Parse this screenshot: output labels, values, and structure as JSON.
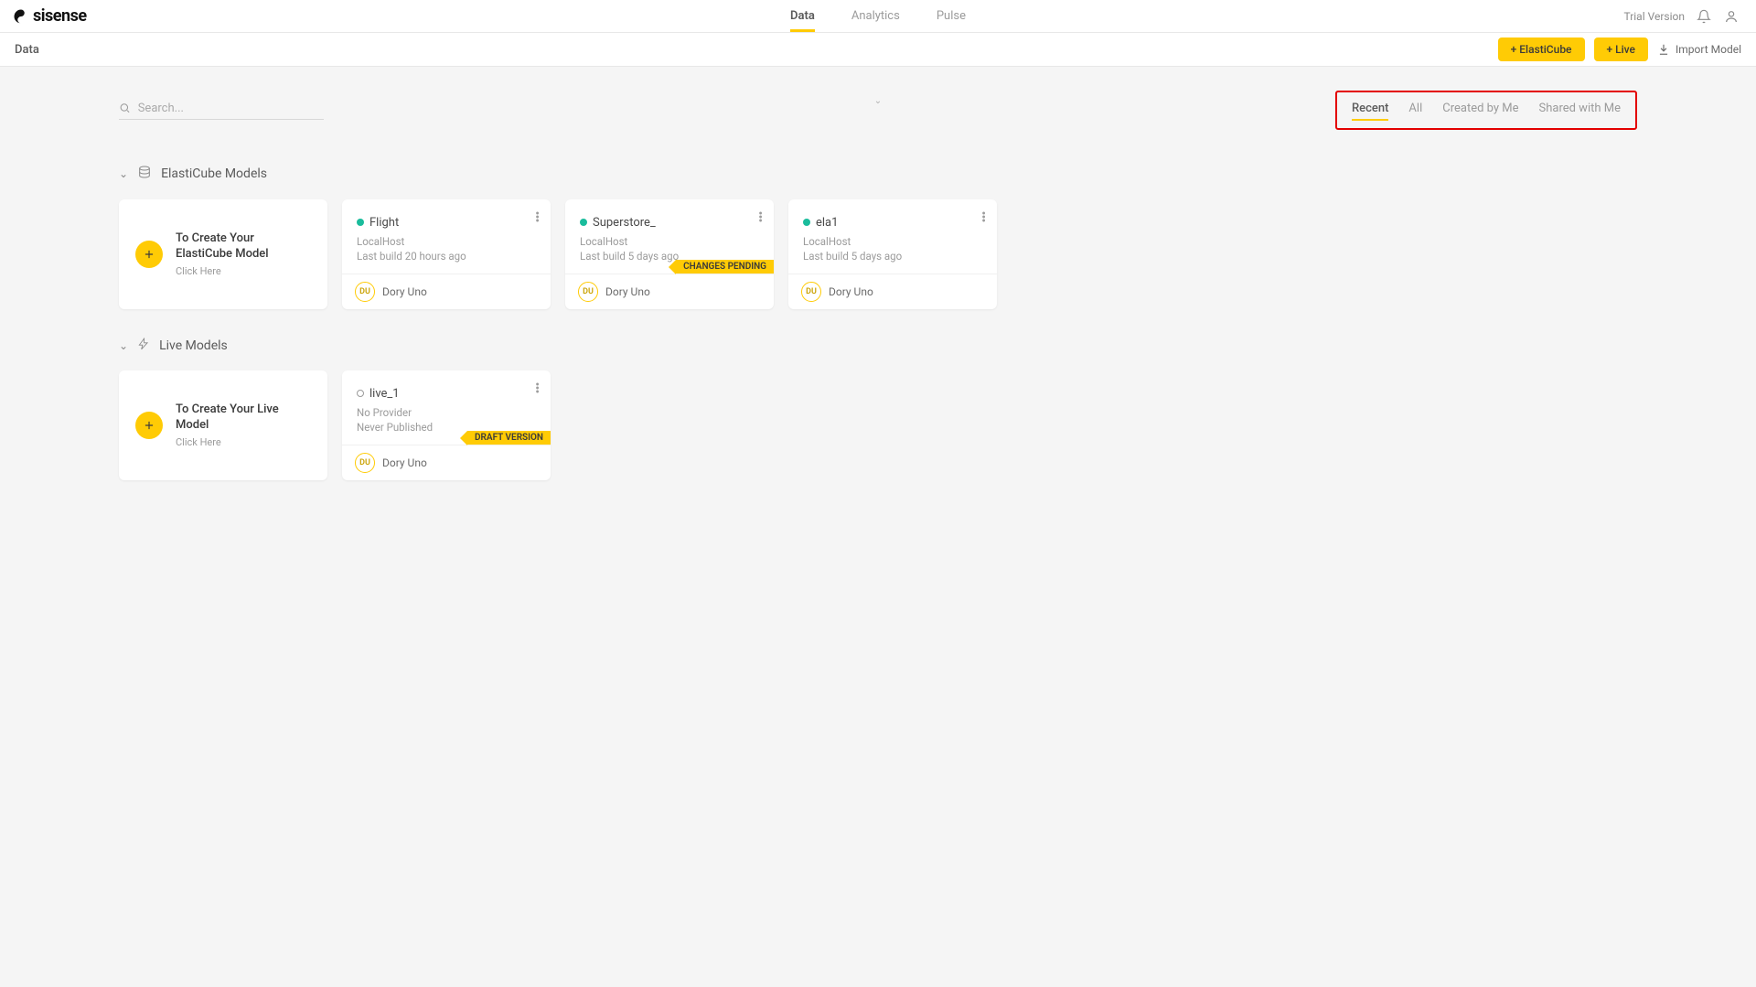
{
  "brand": "sisense",
  "topnav": {
    "tabs": [
      "Data",
      "Analytics",
      "Pulse"
    ],
    "active": 0,
    "trial": "Trial Version"
  },
  "subbar": {
    "title": "Data",
    "btn_elasticube": "+ ElastiCube",
    "btn_live": "+ Live",
    "btn_import": "Import Model"
  },
  "search": {
    "placeholder": "Search..."
  },
  "filters": {
    "tabs": [
      "Recent",
      "All",
      "Created by Me",
      "Shared with Me"
    ],
    "active": 0
  },
  "sections": {
    "elasticube": {
      "title": "ElastiCube Models",
      "create": {
        "line1": "To Create Your ElastiCube Model",
        "line2": "Click Here"
      },
      "cards": [
        {
          "name": "Flight",
          "host": "LocalHost",
          "build": "Last build 20 hours ago",
          "status": "green",
          "flag": "",
          "owner_initials": "DU",
          "owner_name": "Dory Uno"
        },
        {
          "name": "Superstore_",
          "host": "LocalHost",
          "build": "Last build 5 days ago",
          "status": "green",
          "flag": "CHANGES PENDING",
          "owner_initials": "DU",
          "owner_name": "Dory Uno"
        },
        {
          "name": "ela1",
          "host": "LocalHost",
          "build": "Last build 5 days ago",
          "status": "green",
          "flag": "",
          "owner_initials": "DU",
          "owner_name": "Dory Uno"
        }
      ]
    },
    "live": {
      "title": "Live Models",
      "create": {
        "line1": "To Create Your Live Model",
        "line2": "Click Here"
      },
      "cards": [
        {
          "name": "live_1",
          "host": "No Provider",
          "build": "Never Published",
          "status": "empty",
          "flag": "DRAFT VERSION",
          "owner_initials": "DU",
          "owner_name": "Dory Uno"
        }
      ]
    }
  }
}
